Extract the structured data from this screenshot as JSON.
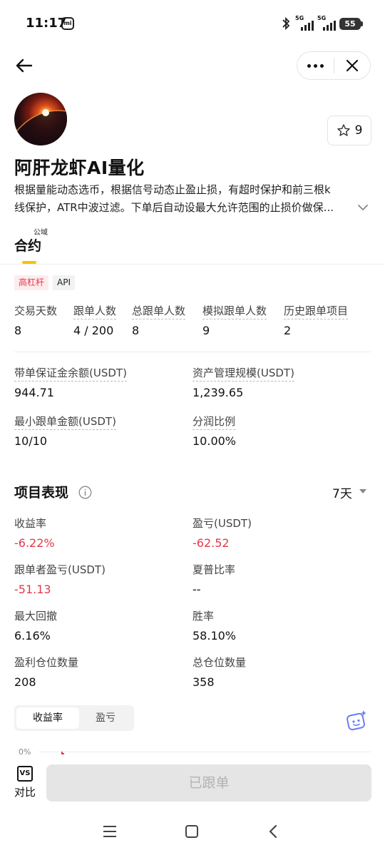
{
  "status_bar": {
    "time": "11:17",
    "carrier_badge": "mi",
    "signal1_tag": "5G",
    "signal2_tag": "5G",
    "battery": "55"
  },
  "header": {
    "back_icon": "arrow-left-icon",
    "more_icon": "more-dots-icon",
    "close_icon": "close-icon"
  },
  "profile": {
    "avatar_icon": "avatar-image",
    "favorite_count": "9",
    "name": "阿肝龙虾AI量化",
    "description_line1": "根据量能动态选币，根据信号动态止盈止损，有超时保护和前三根k",
    "description_line2": "线保护，ATR中波过滤。下单后自动设最大允许范围的止损价做保..."
  },
  "tabs": {
    "sub_label": "公域",
    "main_label": "合约"
  },
  "tags": [
    "高杠杆",
    "API"
  ],
  "stats_row": [
    {
      "label": "交易天数",
      "value": "8"
    },
    {
      "label": "跟单人数",
      "value": "4 / 200"
    },
    {
      "label": "总跟单人数",
      "value": "8"
    },
    {
      "label": "模拟跟单人数",
      "value": "9"
    },
    {
      "label": "历史跟单项目",
      "value": "2"
    }
  ],
  "funds": [
    {
      "label": "带单保证金余额(USDT)",
      "value": "944.71"
    },
    {
      "label": "资产管理规模(USDT)",
      "value": "1,239.65"
    },
    {
      "label": "最小跟单金额(USDT)",
      "value": "10/10"
    },
    {
      "label": "分润比例",
      "value": "10.00%"
    }
  ],
  "performance": {
    "title": "项目表现",
    "period": "7天",
    "metrics": [
      {
        "label": "收益率",
        "value": "-6.22%"
      },
      {
        "label": "盈亏(USDT)",
        "value": "-62.52"
      },
      {
        "label": "跟单者盈亏(USDT)",
        "value": "-51.13"
      },
      {
        "label": "夏普比率",
        "value": "--"
      },
      {
        "label": "最大回撤",
        "value": "6.16%"
      },
      {
        "label": "胜率",
        "value": "58.10%"
      },
      {
        "label": "盈利仓位数量",
        "value": "208"
      },
      {
        "label": "总仓位数量",
        "value": "358"
      }
    ],
    "segment": [
      "收益率",
      "盈亏"
    ],
    "chart_axis_label": "0%"
  },
  "bottom": {
    "compare_icon_text": "VS",
    "compare_label": "对比",
    "follow_button": "已跟单"
  },
  "colors": {
    "accent": "#f5c400",
    "negative": "#e2394d",
    "ai_icon": "#6b7cf6"
  }
}
